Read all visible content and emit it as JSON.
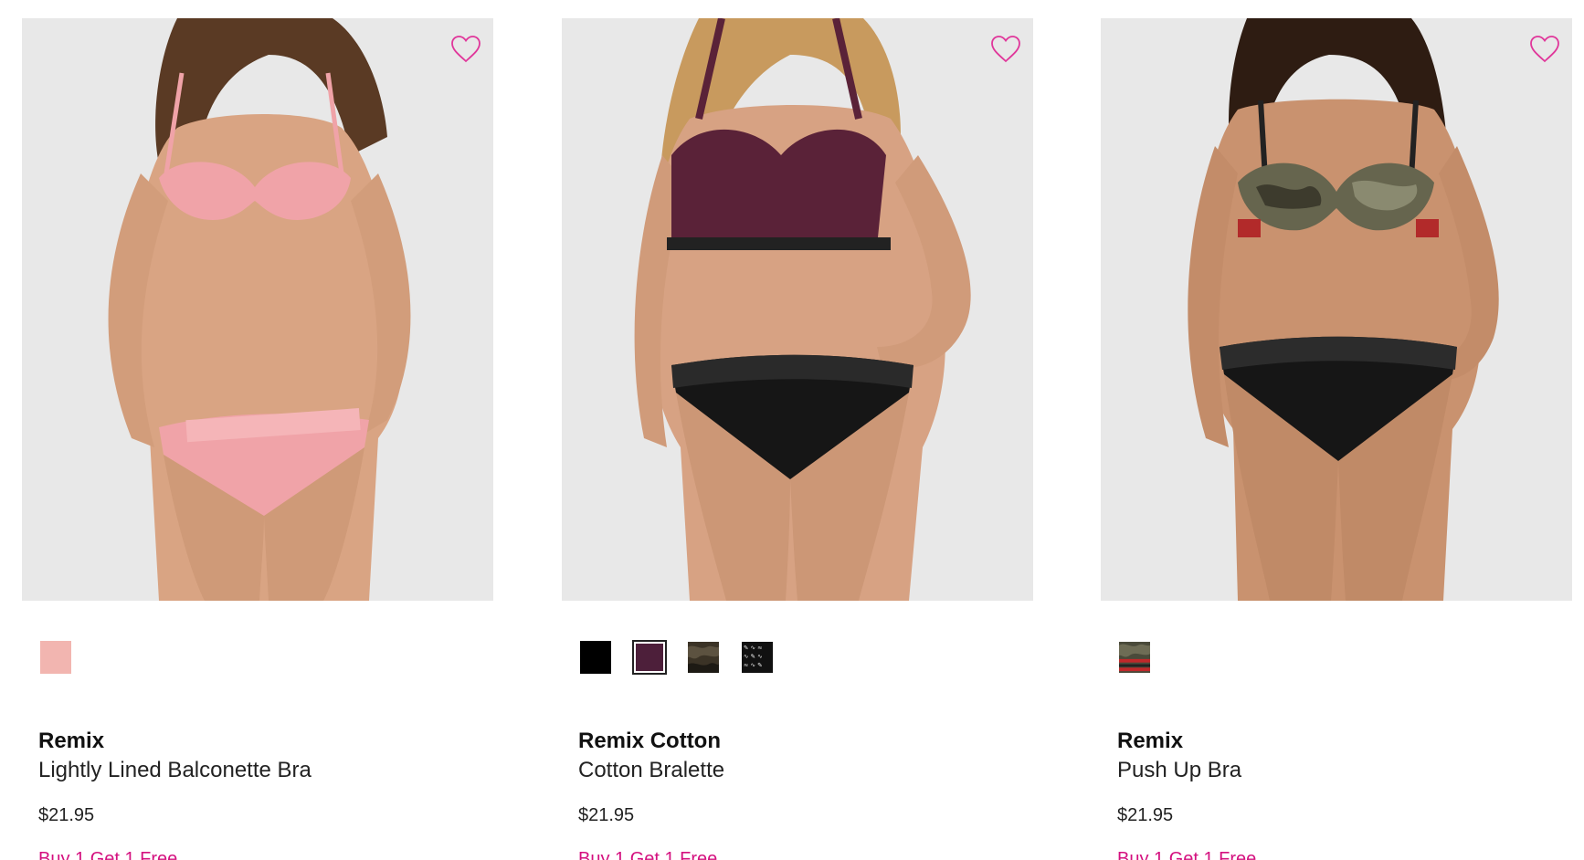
{
  "colors": {
    "accent": "#d4107f",
    "image_bg": "#e8e8e8",
    "heart": "#e0369a"
  },
  "products": [
    {
      "brand": "Remix",
      "name": "Lightly Lined Balconette Bra",
      "price": "$21.95",
      "promo": "Buy 1 Get 1 Free",
      "image_alt": "Model wearing pink lightly lined balconette bra with pink panty",
      "swatches": [
        {
          "color": "#f2b5b0",
          "selected": false
        }
      ]
    },
    {
      "brand": "Remix Cotton",
      "name": "Cotton Bralette",
      "price": "$21.95",
      "promo": "Buy 1 Get 1 Free",
      "image_alt": "Model wearing plum cotton bralette with black lace panty",
      "swatches": [
        {
          "color": "#000000",
          "selected": false
        },
        {
          "color": "#4d1f3a",
          "selected": true
        },
        {
          "color": "camo",
          "selected": false
        },
        {
          "color": "print",
          "selected": false
        }
      ]
    },
    {
      "brand": "Remix",
      "name": "Push Up Bra",
      "price": "$21.95",
      "promo": "Buy 1 Get 1 Free",
      "image_alt": "Model wearing camo push up bra with black lace panty",
      "swatches": [
        {
          "color": "camo-red",
          "selected": false
        }
      ]
    }
  ]
}
